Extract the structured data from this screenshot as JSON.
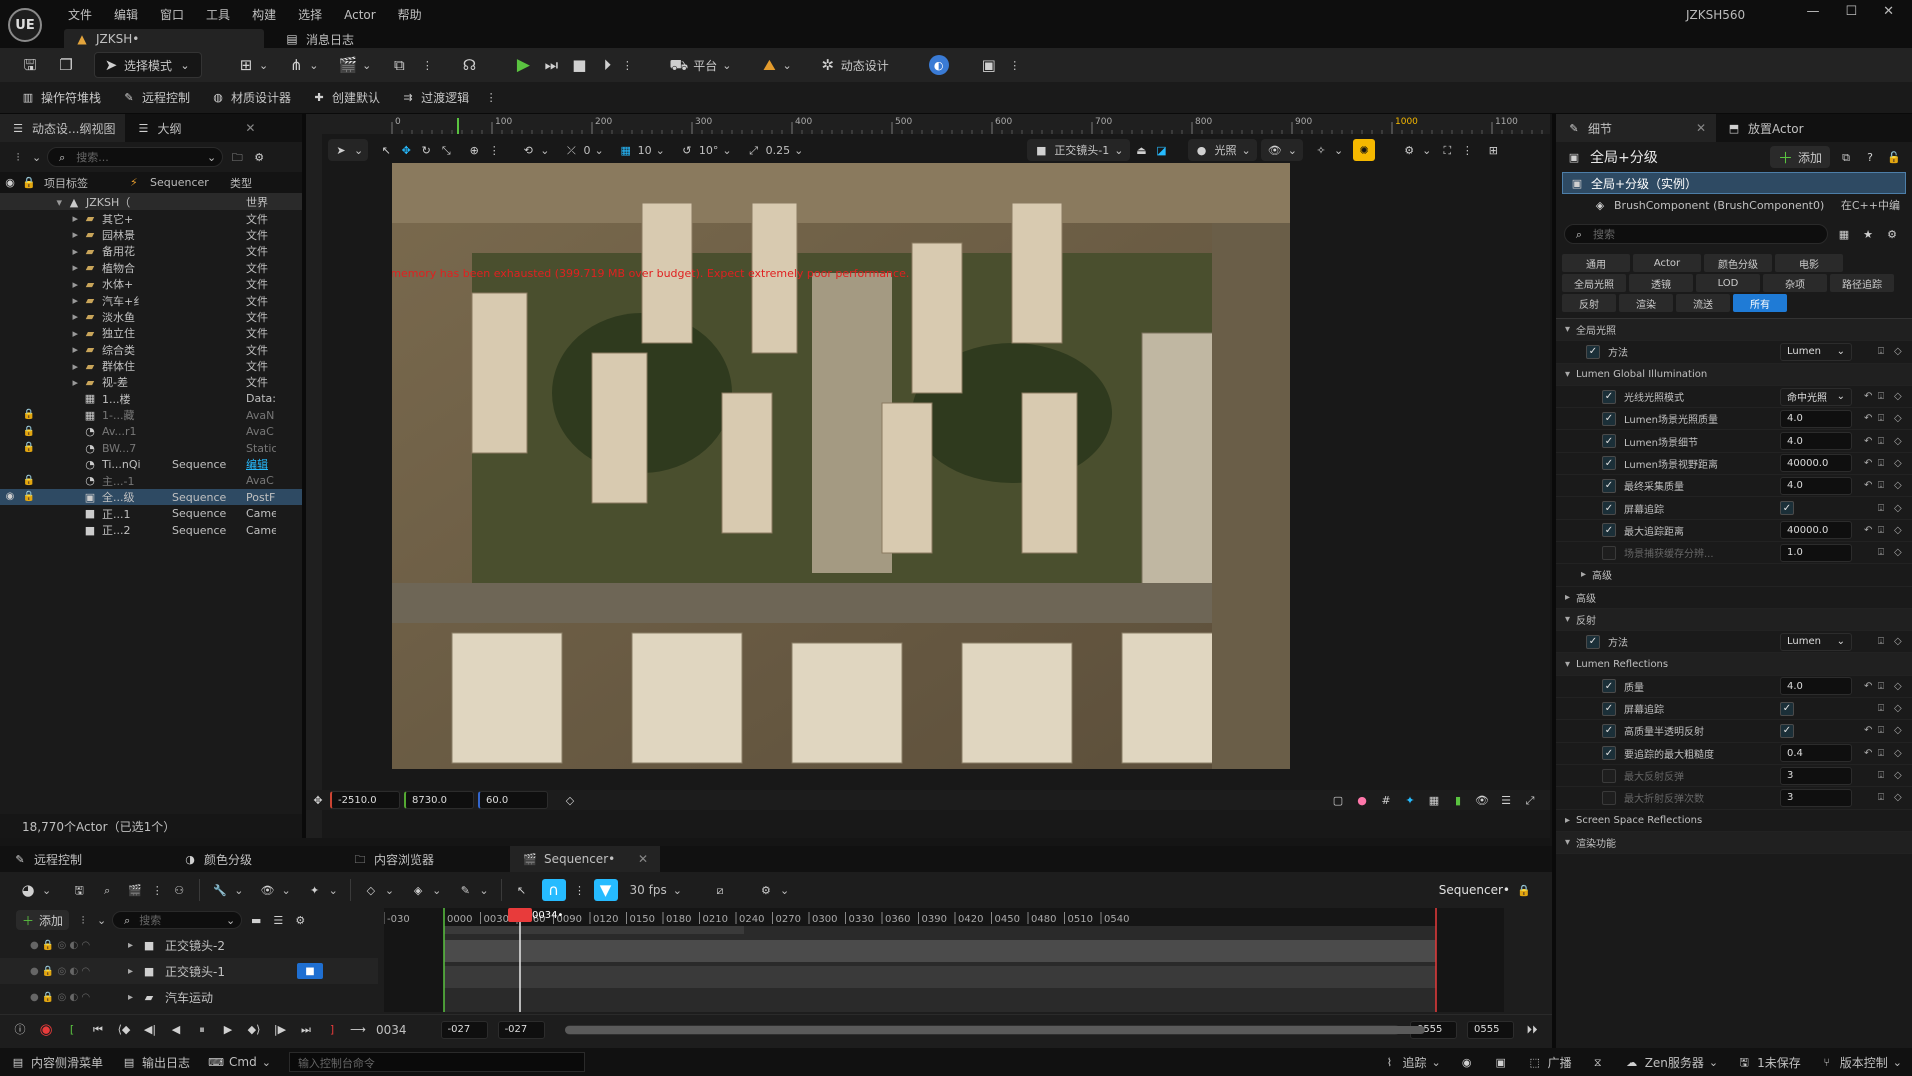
{
  "app": {
    "logo": "UE",
    "menu": [
      "文件",
      "编辑",
      "窗口",
      "工具",
      "构建",
      "选择",
      "Actor",
      "帮助"
    ],
    "project": "JZKSH560",
    "window_controls": [
      "—",
      "☐",
      "✕"
    ]
  },
  "tabs": [
    {
      "label": "JZKSH•",
      "active": true
    },
    {
      "label": "消息日志",
      "active": false
    }
  ],
  "toolbar1": {
    "mode": "选择模式",
    "platform": "平台",
    "motion_design": "动态设计"
  },
  "toolbar2": [
    "操作符堆栈",
    "远程控制",
    "材质设计器",
    "创建默认",
    "过渡逻辑"
  ],
  "outliner": {
    "tab1": "动态设...纲视图",
    "tab2": "大纲",
    "search_placeholder": "搜索...",
    "col_label": "项目标签",
    "col_seq": "Sequencer",
    "col_type": "类型",
    "rows": [
      {
        "name": "JZKSH（",
        "seq": "",
        "type": "世界",
        "depth": 0,
        "icon": "level-icon",
        "lock": false,
        "eye": false,
        "sel": true
      },
      {
        "name": "其它+",
        "seq": "",
        "type": "文件",
        "depth": 1,
        "icon": "folder-icon"
      },
      {
        "name": "园林景",
        "seq": "",
        "type": "文件",
        "depth": 1,
        "icon": "folder-icon"
      },
      {
        "name": "备用花",
        "seq": "",
        "type": "文件",
        "depth": 1,
        "icon": "folder-icon"
      },
      {
        "name": "植物合",
        "seq": "",
        "type": "文件",
        "depth": 1,
        "icon": "folder-icon"
      },
      {
        "name": "水体+",
        "seq": "",
        "type": "文件",
        "depth": 1,
        "icon": "folder-icon"
      },
      {
        "name": "汽车+纟",
        "seq": "",
        "type": "文件",
        "depth": 1,
        "icon": "folder-icon"
      },
      {
        "name": "淡水鱼",
        "seq": "",
        "type": "文件",
        "depth": 1,
        "icon": "folder-icon"
      },
      {
        "name": "独立住",
        "seq": "",
        "type": "文件",
        "depth": 1,
        "icon": "folder-icon"
      },
      {
        "name": "综合类",
        "seq": "",
        "type": "文件",
        "depth": 1,
        "icon": "folder-icon"
      },
      {
        "name": "群体住",
        "seq": "",
        "type": "文件",
        "depth": 1,
        "icon": "folder-icon"
      },
      {
        "name": "视-差",
        "seq": "",
        "type": "文件",
        "depth": 1,
        "icon": "folder-icon"
      },
      {
        "name": "1...楼",
        "seq": "",
        "type": "Data:",
        "depth": 1,
        "icon": "box-icon"
      },
      {
        "name": "1-...藏",
        "seq": "",
        "type": "AvaN",
        "depth": 1,
        "icon": "box-icon",
        "lock": true,
        "dim": true
      },
      {
        "name": "Av...r1",
        "seq": "",
        "type": "AvaC",
        "depth": 1,
        "icon": "actor-icon",
        "lock": true,
        "dim": true
      },
      {
        "name": "BW...7",
        "seq": "",
        "type": "Static",
        "depth": 1,
        "icon": "actor-icon",
        "lock": true,
        "dim": true
      },
      {
        "name": "Ti...nQi",
        "seq": "Sequence",
        "type": "编辑",
        "depth": 1,
        "icon": "actor-icon",
        "link": true
      },
      {
        "name": "主...-1",
        "seq": "",
        "type": "AvaC",
        "depth": 1,
        "icon": "actor-icon",
        "lock": true,
        "dim": true
      },
      {
        "name": "全...级",
        "seq": "Sequence",
        "type": "PostF",
        "depth": 1,
        "icon": "postprocess-icon",
        "lock": true,
        "eye": true,
        "sel": true
      },
      {
        "name": "正...1",
        "seq": "Sequence",
        "type": "Came",
        "depth": 1,
        "icon": "camera-icon"
      },
      {
        "name": "正...2",
        "seq": "Sequence",
        "type": "Came",
        "depth": 1,
        "icon": "camera-icon"
      }
    ],
    "count": "18,770个Actor（已选1个）"
  },
  "viewport": {
    "ruler": [
      "0",
      "100",
      "200",
      "300",
      "400",
      "500",
      "600",
      "700",
      "800",
      "900",
      "1000",
      "1100"
    ],
    "highlight_tick": "1000",
    "tools": {
      "snap_move": "0",
      "snap_grid": "10",
      "snap_rot": "10°",
      "snap_scale": "0.25"
    },
    "camera": "正交镜头-1",
    "lighting": "光照",
    "warning": "Video memory has been exhausted (399.719 MB over budget). Expect extremely poor performance.",
    "coords": {
      "x": "-2510.0",
      "y": "8730.0",
      "z": "60.0"
    }
  },
  "details": {
    "tab1": "细节",
    "tab2": "放置Actor",
    "title": "全局+分级",
    "add": "添加",
    "instance": "全局+分级（实例）",
    "component": "BrushComponent (BrushComponent0)",
    "component_link": "在C++中编",
    "search_placeholder": "搜索",
    "filters": [
      [
        "通用",
        "Actor",
        "颜色分级",
        "电影"
      ],
      [
        "全局光照",
        "透镜",
        "LOD",
        "杂项",
        "路径追踪"
      ],
      [
        "反射",
        "渲染",
        "流送",
        "所有"
      ]
    ],
    "props": [
      {
        "type": "cat",
        "label": "全局光照",
        "indent": 0
      },
      {
        "type": "prop",
        "label": "方法",
        "value": "Lumen",
        "kind": "dropdown",
        "indent": 1,
        "chk": true
      },
      {
        "type": "cat",
        "label": "Lumen Global Illumination",
        "indent": 0
      },
      {
        "type": "prop",
        "label": "光线光照模式",
        "value": "命中光照",
        "kind": "dropdown",
        "indent": 2,
        "chk": true,
        "reset": true
      },
      {
        "type": "prop",
        "label": "Lumen场景光照质量",
        "value": "4.0",
        "kind": "field",
        "indent": 2,
        "chk": true,
        "reset": true
      },
      {
        "type": "prop",
        "label": "Lumen场景细节",
        "value": "4.0",
        "kind": "field",
        "indent": 2,
        "chk": true,
        "reset": true
      },
      {
        "type": "prop",
        "label": "Lumen场景视野距离",
        "value": "40000.0",
        "kind": "field",
        "indent": 2,
        "chk": true,
        "reset": true
      },
      {
        "type": "prop",
        "label": "最终采集质量",
        "value": "4.0",
        "kind": "field",
        "indent": 2,
        "chk": true,
        "reset": true
      },
      {
        "type": "prop",
        "label": "屏幕追踪",
        "value": "",
        "kind": "check",
        "indent": 2,
        "chk": true
      },
      {
        "type": "prop",
        "label": "最大追踪距离",
        "value": "40000.0",
        "kind": "field",
        "indent": 2,
        "chk": true,
        "reset": true
      },
      {
        "type": "prop",
        "label": "场景捕获缓存分辨...",
        "value": "1.0",
        "kind": "field",
        "indent": 2,
        "chk": false,
        "dim": true
      },
      {
        "type": "sub",
        "label": "高级",
        "indent": 1
      },
      {
        "type": "sub",
        "label": "高级",
        "indent": 0
      },
      {
        "type": "cat",
        "label": "反射",
        "indent": 0
      },
      {
        "type": "prop",
        "label": "方法",
        "value": "Lumen",
        "kind": "dropdown",
        "indent": 1,
        "chk": true
      },
      {
        "type": "cat",
        "label": "Lumen Reflections",
        "indent": 0
      },
      {
        "type": "prop",
        "label": "质量",
        "value": "4.0",
        "kind": "field",
        "indent": 2,
        "chk": true,
        "reset": true
      },
      {
        "type": "prop",
        "label": "屏幕追踪",
        "value": "",
        "kind": "check",
        "indent": 2,
        "chk": true
      },
      {
        "type": "prop",
        "label": "高质量半透明反射",
        "value": "",
        "kind": "check",
        "indent": 2,
        "chk": true,
        "reset": true
      },
      {
        "type": "prop",
        "label": "要追踪的最大粗糙度",
        "value": "0.4",
        "kind": "field",
        "indent": 2,
        "chk": true,
        "reset": true
      },
      {
        "type": "prop",
        "label": "最大反射反弹",
        "value": "3",
        "kind": "field",
        "indent": 2,
        "chk": false,
        "dim": true
      },
      {
        "type": "prop",
        "label": "最大折射反弹次数",
        "value": "3",
        "kind": "field",
        "indent": 2,
        "chk": false,
        "dim": true
      },
      {
        "type": "sub",
        "label": "Screen Space Reflections",
        "indent": 0
      },
      {
        "type": "cat",
        "label": "渲染功能",
        "indent": 0
      }
    ]
  },
  "bottom_tabs": [
    "远程控制",
    "颜色分级",
    "内容浏览器",
    "Sequencer•"
  ],
  "sequencer": {
    "add": "添加",
    "search_placeholder": "搜索",
    "fps": "30 fps",
    "name": "Sequencer•",
    "playhead": "0034•",
    "ticks": [
      "-030",
      "0000",
      "0030",
      "0060",
      "0090",
      "0120",
      "0150",
      "0180",
      "0210",
      "0240",
      "0270",
      "0300",
      "0330",
      "0360",
      "0390",
      "0420",
      "0450",
      "0480",
      "0510",
      "0540"
    ],
    "tracks": [
      "正交镜头-2",
      "正交镜头-1",
      "汽车运动"
    ],
    "transport": {
      "frame": "0034",
      "start": "-027",
      "start2": "-027",
      "end": "0555",
      "end2": "0555"
    }
  },
  "statusbar": {
    "drawer": "内容侧滑菜单",
    "log": "输出日志",
    "cmd": "Cmd",
    "cmd_placeholder": "输入控制台命令",
    "trace": "追踪",
    "broadcast": "广播",
    "zen": "Zen服务器",
    "unsaved": "1未保存",
    "vcs": "版本控制"
  },
  "colors": {
    "accent": "#26bbff",
    "play": "#5ac340",
    "warning": "#e02020",
    "playhead": "#e83b3b"
  }
}
